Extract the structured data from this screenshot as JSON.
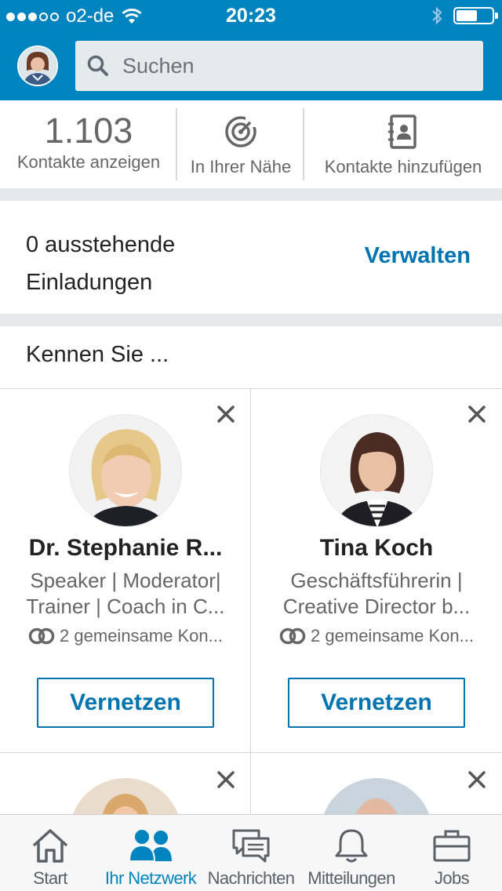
{
  "status_bar": {
    "carrier": "o2-de",
    "time": "20:23"
  },
  "search": {
    "placeholder": "Suchen"
  },
  "top_actions": [
    {
      "count": "1.103",
      "label": "Kontakte anzeigen"
    },
    {
      "label": "In Ihrer Nähe",
      "icon": "radar-icon"
    },
    {
      "label": "Kontakte hinzufügen",
      "icon": "address-book-icon"
    }
  ],
  "invitations": {
    "text": "0 ausstehende Einladungen",
    "manage_label": "Verwalten"
  },
  "suggestions": {
    "title": "Kennen Sie ...",
    "cards": [
      {
        "name": "Dr. Stephanie R...",
        "headline_1": "Speaker | Moderator|",
        "headline_2": "Trainer | Coach in C...",
        "mutual": "2 gemeinsame Kon...",
        "connect_label": "Vernetzen"
      },
      {
        "name": "Tina Koch",
        "headline_1": "Geschäftsführerin |",
        "headline_2": "Creative Director b...",
        "mutual": "2 gemeinsame Kon...",
        "connect_label": "Vernetzen"
      }
    ]
  },
  "tabbar": {
    "items": [
      {
        "label": "Start",
        "icon": "home-icon"
      },
      {
        "label": "Ihr Netzwerk",
        "icon": "people-icon",
        "active": true
      },
      {
        "label": "Nachrichten",
        "icon": "messages-icon"
      },
      {
        "label": "Mitteilungen",
        "icon": "bell-icon"
      },
      {
        "label": "Jobs",
        "icon": "briefcase-icon"
      }
    ]
  },
  "colors": {
    "brand": "#0084bf",
    "link": "#0074b1",
    "separator": "#e6e9ec"
  }
}
